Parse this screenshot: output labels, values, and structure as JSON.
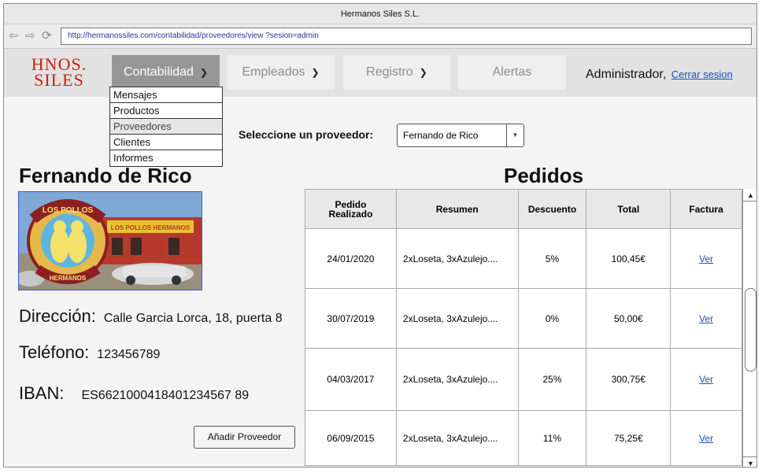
{
  "window": {
    "title": "Hermanos Siles S.L."
  },
  "browser": {
    "url": "http://hermanossiles.com/contabilidad/proveedores/view ?sesion=admin"
  },
  "logo": {
    "line1": "HNOS.",
    "line2": "SILES"
  },
  "nav": {
    "tabs": [
      {
        "label": "Contabilidad"
      },
      {
        "label": "Empleados"
      },
      {
        "label": "Registro"
      },
      {
        "label": "Alertas"
      }
    ]
  },
  "user": {
    "name": "Administrador,",
    "logout": "Cerrar sesion"
  },
  "menu": {
    "items": [
      "Mensajes",
      "Productos",
      "Proveedores",
      "Clientes",
      "Informes"
    ],
    "highlighted": "Proveedores"
  },
  "selector": {
    "label": "Seleccione un proveedor:",
    "value": "Fernando de Rico"
  },
  "provider": {
    "name": "Fernando de Rico",
    "address_label": "Dirección:",
    "address": "Calle Garcia Lorca, 18, puerta 8",
    "phone_label": "Teléfono:",
    "phone": "123456789",
    "iban_label": "IBAN:",
    "iban": "ES6621000418401234567 89",
    "add_button": "Añadir Proveedor"
  },
  "photo": {
    "sign_text": "LOS POLLOS",
    "sign_text2": "HERMANOS",
    "shop_sign": "LOS POLLOS HERMANOS"
  },
  "orders": {
    "title": "Pedidos",
    "headers": [
      "Pedido Realizado",
      "Resumen",
      "Descuento",
      "Total",
      "Factura"
    ],
    "rows": [
      {
        "date": "24/01/2020",
        "summary": "2xLoseta, 3xAzulejo....",
        "discount": "5%",
        "total": "100,45€",
        "invoice": "Ver"
      },
      {
        "date": "30/07/2019",
        "summary": "2xLoseta, 3xAzulejo....",
        "discount": "0%",
        "total": "50,00€",
        "invoice": "Ver"
      },
      {
        "date": "04/03/2017",
        "summary": "2xLoseta, 3xAzulejo....",
        "discount": "25%",
        "total": "300,75€",
        "invoice": "Ver"
      },
      {
        "date": "06/09/2015",
        "summary": "2xLoseta, 3xAzulejo....",
        "discount": "11%",
        "total": "75,25€",
        "invoice": "Ver"
      }
    ]
  },
  "colors": {
    "accent_link": "#1f4fb5",
    "logo_red": "#d21a1a",
    "active_tab": "#969696"
  }
}
